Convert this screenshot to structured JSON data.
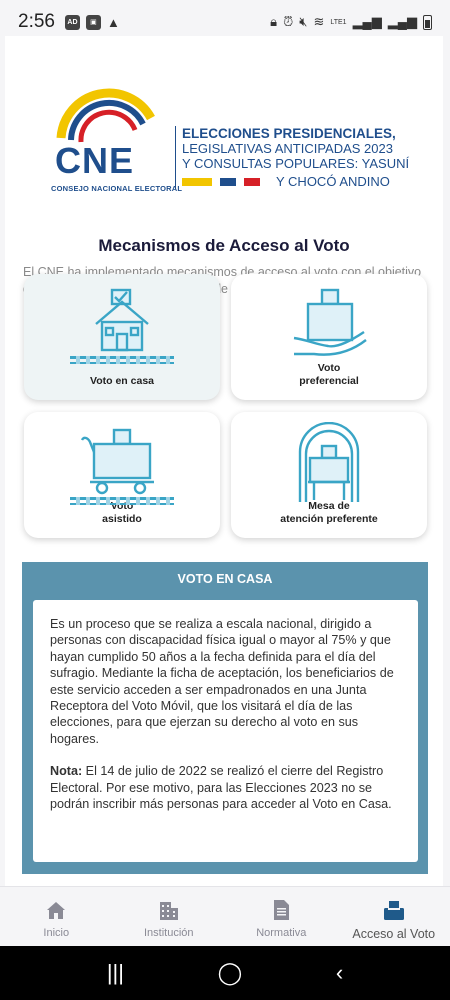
{
  "status_bar": {
    "time": "2:56",
    "network_label": "LTE1"
  },
  "logo": {
    "acronym": "CNE",
    "subtitle": "CONSEJO NACIONAL ELECTORAL",
    "elections_lines": [
      "ELECCIONES PRESIDENCIALES,",
      "LEGISLATIVAS ANTICIPADAS 2023",
      "Y CONSULTAS POPULARES: YASUNÍ",
      "Y CHOCÓ ANDINO"
    ]
  },
  "main": {
    "title": "Mecanismos de Acceso al Voto",
    "description": "El CNE ha implementado mecanismos de acceso al voto con el objetivo de facilitar el ejercicio del sufragio de las personas con discapacidad:",
    "cards": [
      {
        "label": "Voto en casa",
        "icon": "house-ballot-icon"
      },
      {
        "label": "Voto\npreferencial",
        "icon": "hand-ballot-icon"
      },
      {
        "label": "Voto\nasistido",
        "icon": "cart-ballot-icon"
      },
      {
        "label": "Mesa de\natención preferente",
        "icon": "booth-ballot-icon"
      }
    ]
  },
  "info": {
    "title": "VOTO EN CASA",
    "paragraph": "Es un proceso que se realiza a escala nacional, dirigido a personas con discapacidad física igual o mayor al 75% y que hayan cumplido 50 años a la fecha definida para el día del sufragio. Mediante la ficha de aceptación, los beneficiarios de este servicio acceden a ser empadronados en una Junta Receptora del Voto Móvil, que los visitará el día de las elecciones, para que ejerzan su derecho al voto en sus hogares.",
    "note_label": "Nota:",
    "note_text": " El 14 de julio de 2022 se realizó el cierre del Registro Electoral. Por ese motivo, para las Elecciones 2023 no se podrán inscribir más personas para acceder al Voto en Casa."
  },
  "bottom_nav": {
    "items": [
      {
        "label": "Inicio",
        "icon": "home-icon"
      },
      {
        "label": "Institución",
        "icon": "building-icon"
      },
      {
        "label": "Normativa",
        "icon": "document-icon"
      },
      {
        "label": "Acceso al Voto",
        "icon": "ballot-box-icon"
      }
    ],
    "active_index": 3
  },
  "colors": {
    "brand_blue": "#1f4e8c",
    "panel_blue": "#5b93ad",
    "icon_teal": "#3aa5c6",
    "flag_yellow": "#f2c500",
    "flag_red": "#d62027"
  }
}
